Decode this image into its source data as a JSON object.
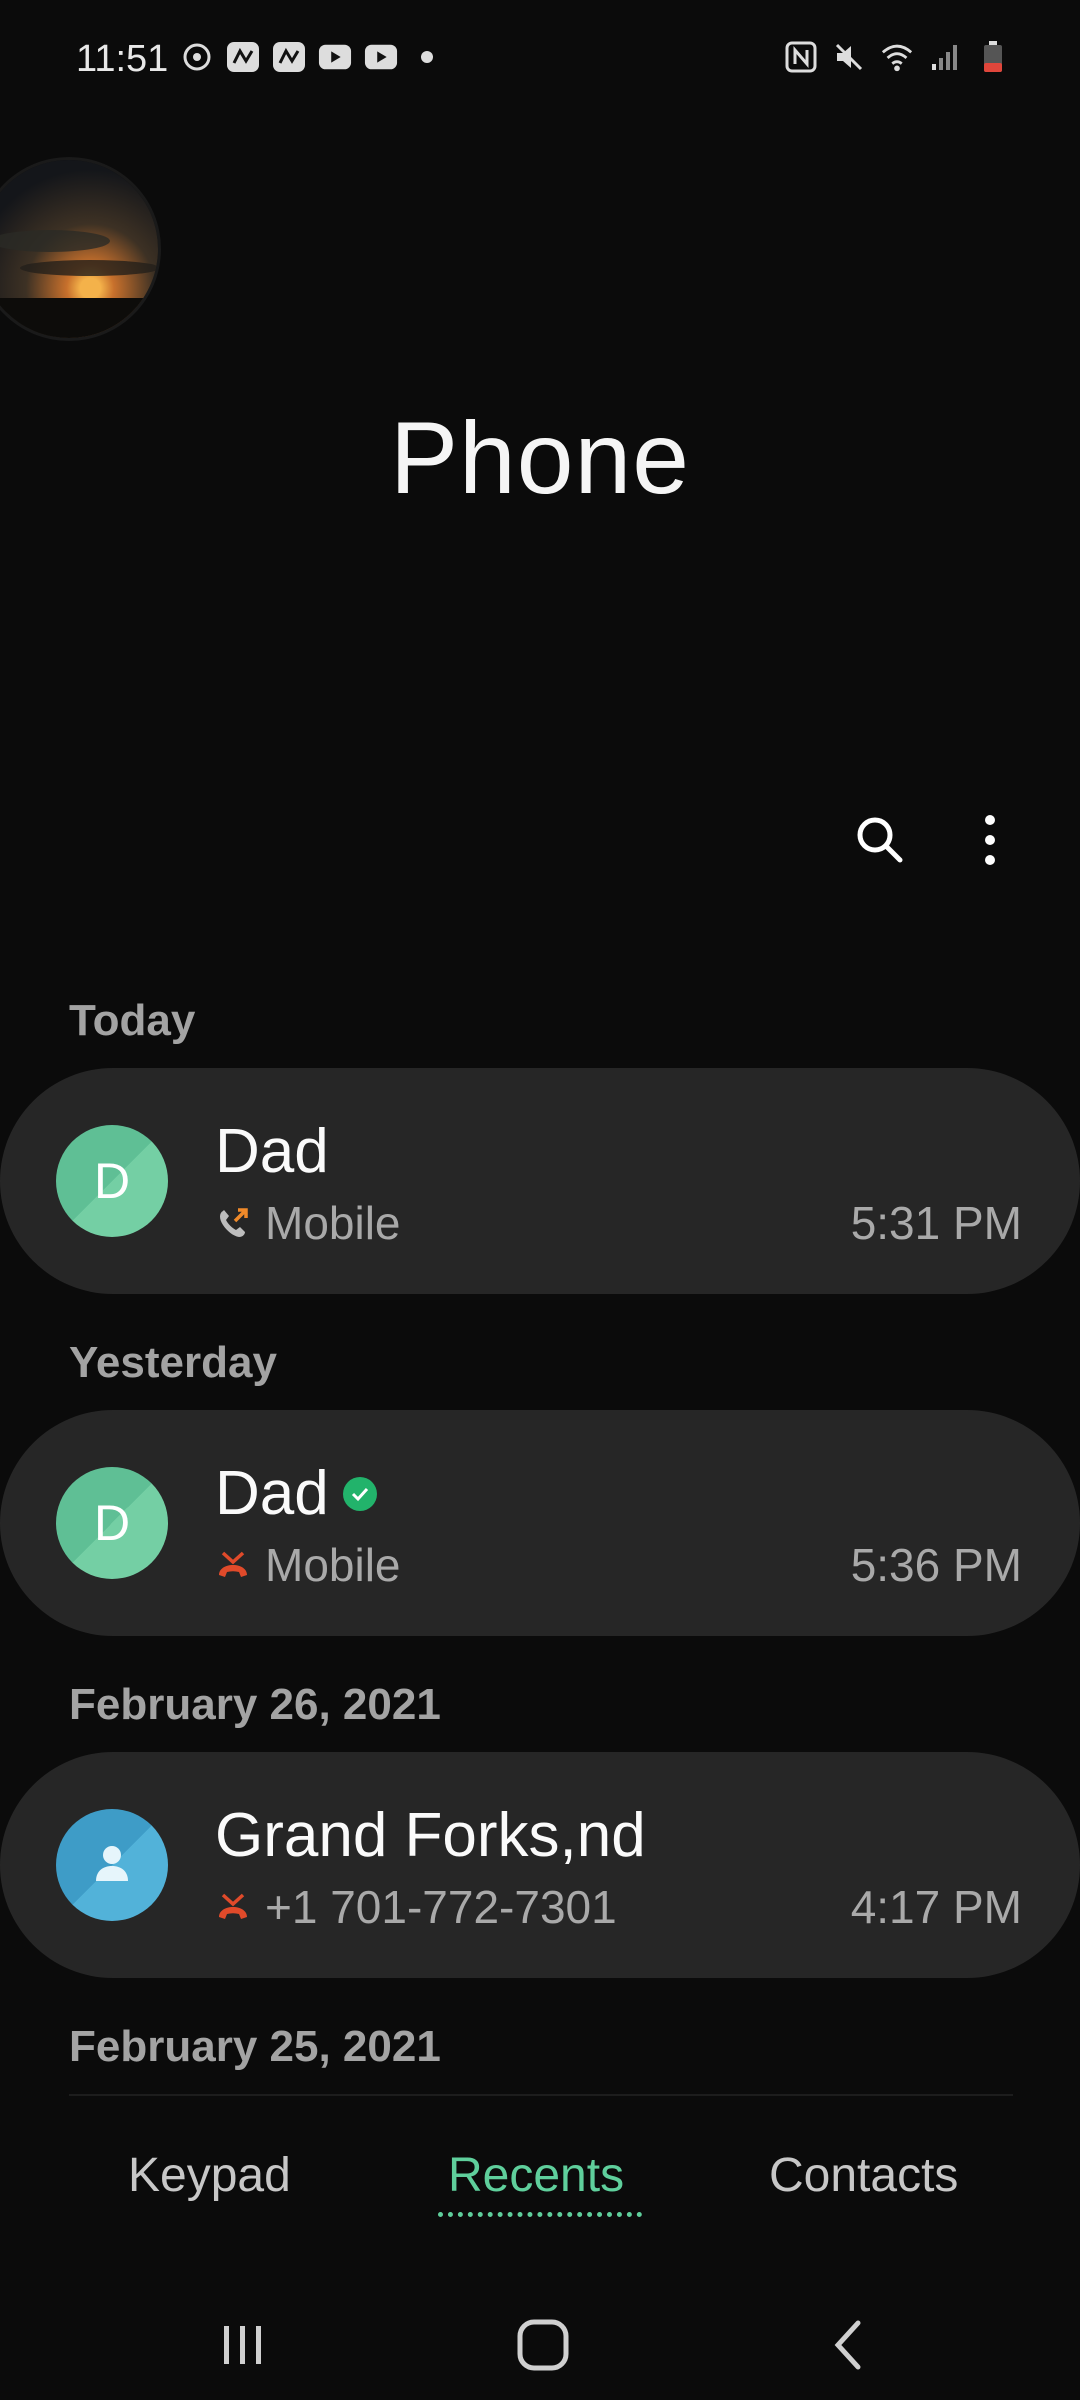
{
  "status_bar": {
    "time": "11:51",
    "left_icons": [
      "sync-icon",
      "app-notification-icon",
      "app-notification-icon",
      "youtube-icon",
      "youtube-icon",
      "dot-icon"
    ],
    "right_icons": [
      "nfc-icon",
      "mute-icon",
      "wifi-icon",
      "signal-icon",
      "battery-low-icon"
    ],
    "battery_color": "#e0463b"
  },
  "header": {
    "title": "Phone"
  },
  "toolbar": {
    "search_icon": "search-icon",
    "more_icon": "more-options-icon"
  },
  "sections": [
    {
      "header": "Today",
      "calls": [
        {
          "name": "Dad",
          "avatar_letter": "D",
          "avatar_color": "#66c79a",
          "verified": false,
          "call_type": "outgoing-call-icon",
          "call_type_color": "#f08a2a",
          "detail": "Mobile",
          "time": "5:31 PM"
        }
      ]
    },
    {
      "header": "Yesterday",
      "calls": [
        {
          "name": "Dad",
          "avatar_letter": "D",
          "avatar_color": "#66c79a",
          "verified": true,
          "call_type": "missed-call-icon",
          "call_type_color": "#e04a2a",
          "detail": "Mobile",
          "time": "5:36 PM"
        }
      ]
    },
    {
      "header": "February 26, 2021",
      "calls": [
        {
          "name": "Grand Forks,nd",
          "avatar_letter": "",
          "avatar_color": "#47a7d0",
          "verified": false,
          "call_type": "missed-call-icon",
          "call_type_color": "#e04a2a",
          "detail": "+1 701-772-7301",
          "time": "4:17 PM"
        }
      ]
    },
    {
      "header": "February 25, 2021",
      "calls": []
    }
  ],
  "tabs": [
    {
      "label": "Keypad",
      "active": false
    },
    {
      "label": "Recents",
      "active": true
    },
    {
      "label": "Contacts",
      "active": false
    }
  ],
  "colors": {
    "background": "#0b0b0b",
    "card": "#262626",
    "accent": "#5fcf9c"
  },
  "nav_bar": [
    "recent-apps-icon",
    "home-icon",
    "back-icon"
  ]
}
